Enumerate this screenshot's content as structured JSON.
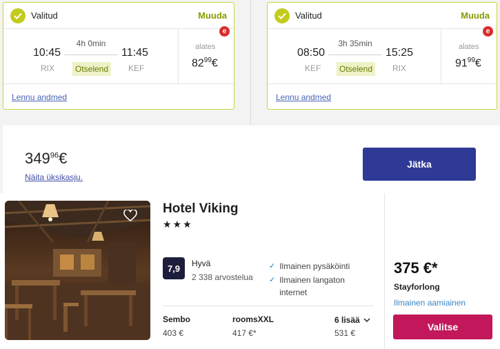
{
  "outbound": {
    "status": "Valitud",
    "change_label": "Muuda",
    "depart_time": "10:45",
    "depart_code": "RIX",
    "duration": "4h 0min",
    "stops": "Otselend",
    "arrive_time": "11:45",
    "arrive_code": "KEF",
    "from_label": "alates",
    "price_main": "82",
    "price_cents": "99",
    "price_currency": "€",
    "badge": "e",
    "details_link": "Lennu andmed"
  },
  "return": {
    "status": "Valitud",
    "change_label": "Muuda",
    "depart_time": "08:50",
    "depart_code": "KEF",
    "duration": "3h 35min",
    "stops": "Otselend",
    "arrive_time": "15:25",
    "arrive_code": "RIX",
    "from_label": "alates",
    "price_main": "91",
    "price_cents": "99",
    "price_currency": "€",
    "badge": "e",
    "details_link": "Lennu andmed"
  },
  "summary": {
    "total_main": "349",
    "total_cents": "96",
    "total_currency": "€",
    "unit_price_link": "Näita üksikasju.",
    "continue_label": "Jätka"
  },
  "hotel": {
    "name": "Hotel Viking",
    "stars": "★★★",
    "score": "7,9",
    "rating_word": "Hyvä",
    "reviews": "2 338 arvostelua",
    "amenities": [
      "Ilmainen pysäköinti",
      "Ilmainen langaton internet"
    ],
    "providers": [
      {
        "name": "Sembo",
        "price": "403 €"
      },
      {
        "name": "roomsXXL",
        "price": "417 €*"
      },
      {
        "name": "6 lisää",
        "price": "531 €"
      }
    ],
    "best_price": "375 €*",
    "best_provider": "Stayforlong",
    "breakfast": "Ilmainen aamiainen",
    "select_label": "Valitse"
  },
  "colors": {
    "accent_green": "#c3cc1e",
    "continue_blue": "#2f3a96",
    "select_pink": "#c2185b",
    "badge_red": "#d92d2d"
  }
}
